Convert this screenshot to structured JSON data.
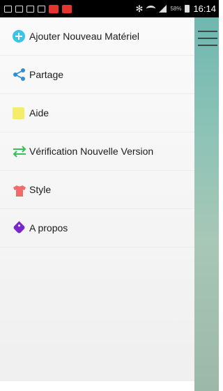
{
  "status_bar": {
    "battery_percent": "58%",
    "time": "16:14"
  },
  "drawer": {
    "items": [
      {
        "label": "Ajouter Nouveau Matériel",
        "icon": "add-circle-icon",
        "color": "#3ec3e8"
      },
      {
        "label": "Partage",
        "icon": "share-icon",
        "color": "#2f8fd6"
      },
      {
        "label": "Aide",
        "icon": "help-icon",
        "color": "#f5ec6a"
      },
      {
        "label": "Vérification Nouvelle Version",
        "icon": "sync-arrows-icon",
        "color": "#32c25a"
      },
      {
        "label": "Style",
        "icon": "tshirt-icon",
        "color": "#f26b6b"
      },
      {
        "label": "A propos",
        "icon": "tag-icon",
        "color": "#7a26c9"
      }
    ]
  }
}
